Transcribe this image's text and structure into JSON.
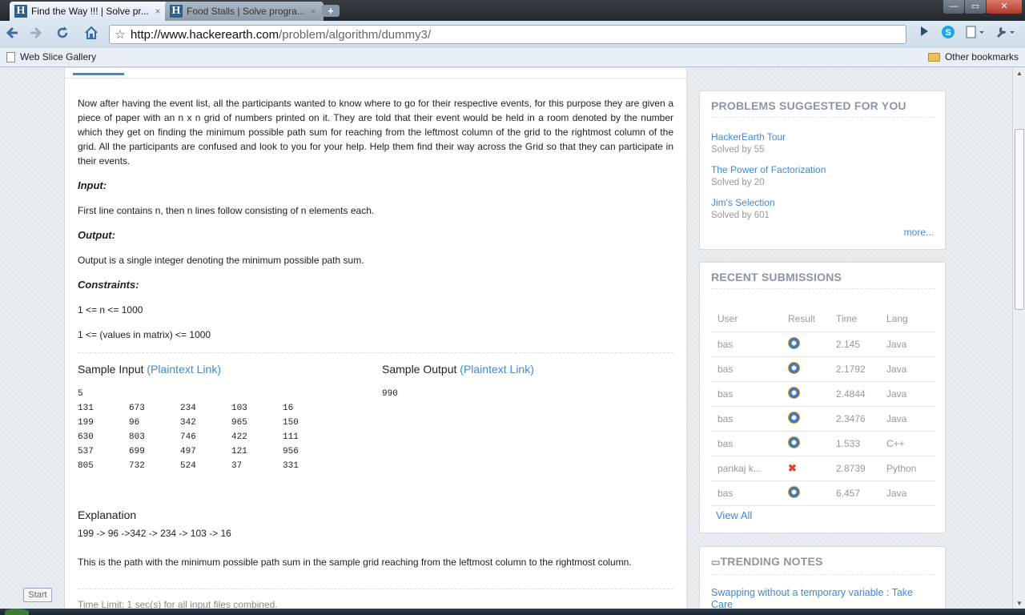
{
  "tabs": [
    {
      "label": "Find the Way !!! | Solve pr...",
      "close": "×"
    },
    {
      "label": "Food Stalls | Solve progra...",
      "close": "×"
    }
  ],
  "new_tab": "+",
  "window_controls": {
    "minimize": "—",
    "maximize": "▭",
    "close": "✕"
  },
  "toolbar": {
    "url_host": "http://www.hackerearth.com",
    "url_path": "/problem/algorithm/dummy3/"
  },
  "bookmarks": {
    "left": "Web Slice Gallery",
    "right": "Other bookmarks"
  },
  "problem": {
    "intro": "Now after having the event list, all the participants wanted to know where to go for their respective events, for this purpose they are given a piece of paper with an n x n grid of numbers printed on it. They are told that their event would be held in a room denoted by the number which they get on finding the minimum possible path sum for reaching from the leftmost column of the grid to the rightmost column of the grid. All the participants are confused and look to you for your help. Help them find their way across the Grid so that they can participate in their events.",
    "input_head": "Input:",
    "input_text": "First line contains n, then n lines follow consisting of n elements each.",
    "output_head": "Output:",
    "output_text": "Output is a single integer denoting the minimum possible path sum.",
    "constraints_head": "Constraints:",
    "constraint1": "1 <= n <= 1000",
    "constraint2": "1 <= (values in matrix) <= 1000",
    "sample_input_title": "Sample Input",
    "sample_output_title": "Sample Output",
    "plaintext_link": "(Plaintext Link)",
    "sample_input_n": "5",
    "sample_grid": [
      [
        "131",
        "673",
        "234",
        "103",
        "16"
      ],
      [
        "199",
        "96",
        "342",
        "965",
        "150"
      ],
      [
        "630",
        "803",
        "746",
        "422",
        "111"
      ],
      [
        "537",
        "699",
        "497",
        "121",
        "956"
      ],
      [
        "805",
        "732",
        "524",
        "37",
        "331"
      ]
    ],
    "sample_output": "990",
    "explanation_head": "Explanation",
    "explanation_path": "199 -> 96 ->342 -> 234 -> 103 -> 16",
    "explanation_text": "This is the path with the minimum possible path sum in the sample grid reaching from the leftmost column to the rightmost column.",
    "time_limit": "Time Limit: 1 sec(s) for all input files combined."
  },
  "suggested": {
    "heading": "PROBLEMS SUGGESTED FOR YOU",
    "items": [
      {
        "title": "HackerEarth Tour",
        "solved": "Solved by 55"
      },
      {
        "title": "The Power of Factorization",
        "solved": "Solved by 20"
      },
      {
        "title": "Jim's Selection",
        "solved": "Solved by 601"
      }
    ],
    "more": "more..."
  },
  "recent": {
    "heading": "RECENT SUBMISSIONS",
    "columns": [
      "User",
      "Result",
      "Time",
      "Lang"
    ],
    "rows": [
      {
        "user": "bas",
        "result": "ok",
        "time": "2.145",
        "lang": "Java"
      },
      {
        "user": "bas",
        "result": "ok",
        "time": "2.1792",
        "lang": "Java"
      },
      {
        "user": "bas",
        "result": "ok",
        "time": "2.4844",
        "lang": "Java"
      },
      {
        "user": "bas",
        "result": "ok",
        "time": "2.3476",
        "lang": "Java"
      },
      {
        "user": "bas",
        "result": "ok",
        "time": "1.533",
        "lang": "C++"
      },
      {
        "user": "pankaj k...",
        "result": "fail",
        "time": "2.8739",
        "lang": "Python"
      },
      {
        "user": "bas",
        "result": "ok",
        "time": "6.457",
        "lang": "Java"
      }
    ],
    "view_all": "View All"
  },
  "trending": {
    "heading": "TRENDING NOTES",
    "first_note": "Swapping without a temporary variable : Take Care"
  },
  "start_button": "Start"
}
